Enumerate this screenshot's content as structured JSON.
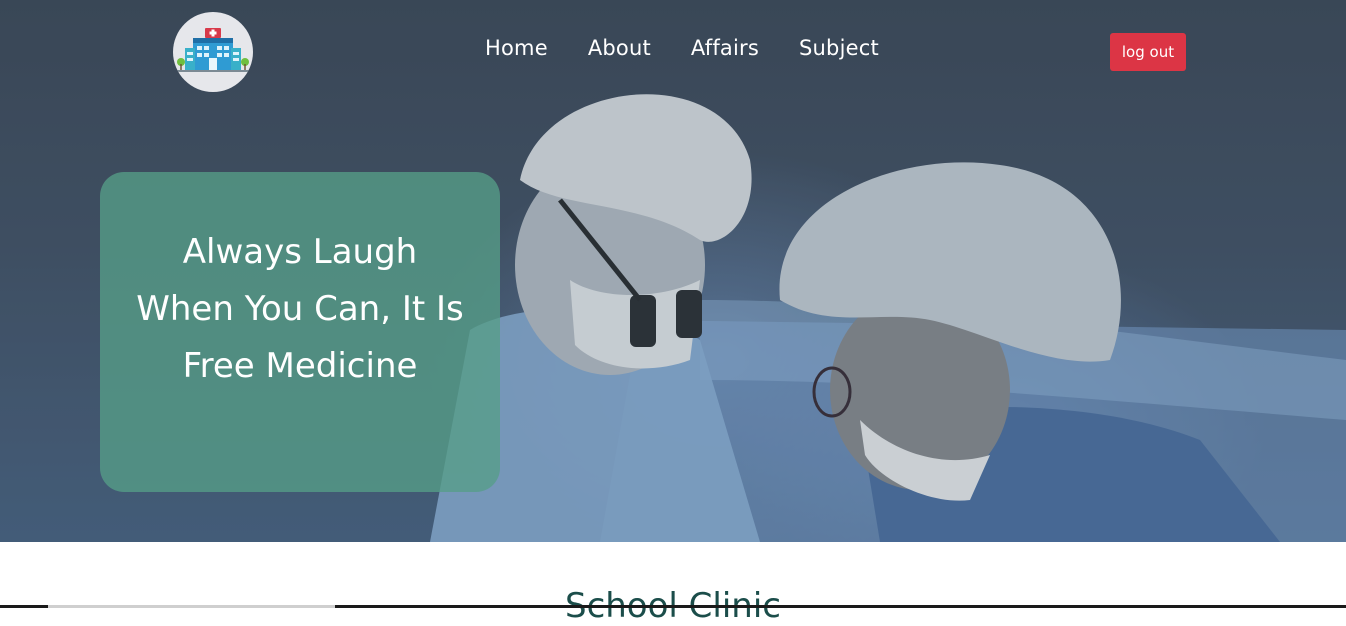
{
  "header": {
    "logo_label": "HOSPITAL",
    "nav": [
      {
        "label": "Home"
      },
      {
        "label": "About"
      },
      {
        "label": "Affairs"
      },
      {
        "label": "Subject"
      }
    ],
    "logout_label": "log out"
  },
  "hero": {
    "quote": "Always Laugh When You Can, It Is Free Medicine"
  },
  "section": {
    "heading": "School Clinic"
  },
  "colors": {
    "logout_bg": "#dc3545",
    "quote_card_bg": "#569e88",
    "heading": "#1b4d4a"
  }
}
